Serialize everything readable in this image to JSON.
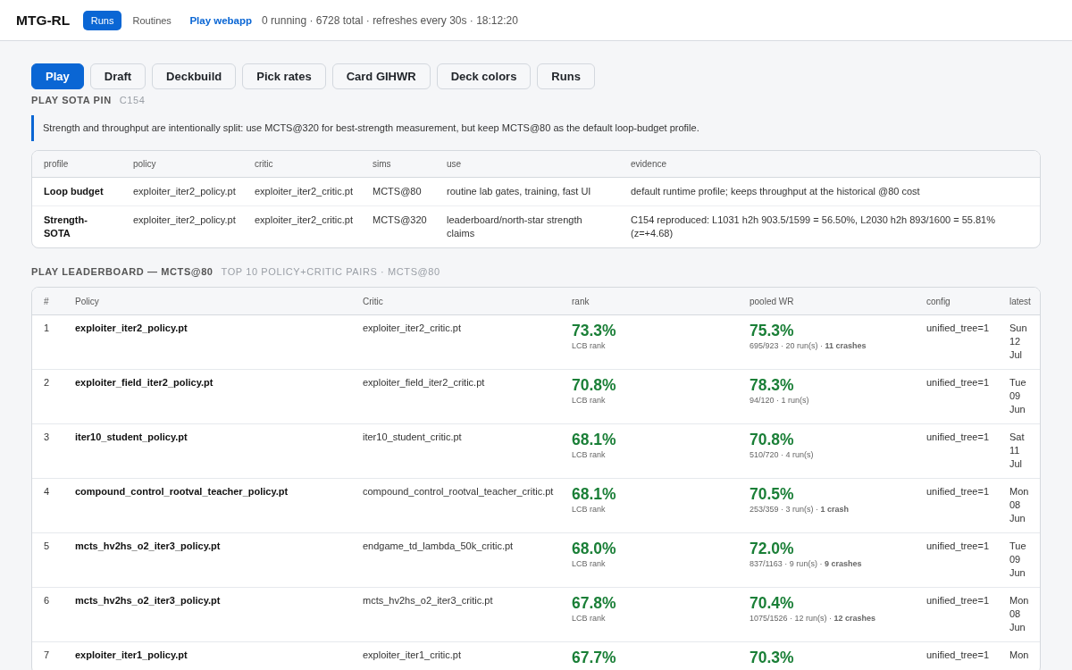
{
  "header": {
    "title": "MTG-RL",
    "nav": [
      {
        "label": "Runs",
        "selected": true
      },
      {
        "label": "Routines",
        "selected": false
      }
    ],
    "link": "Play webapp",
    "status": "0 running · 6728 total · refreshes every 30s · 18:12:20"
  },
  "tabs": [
    {
      "label": "Play",
      "selected": true
    },
    {
      "label": "Draft",
      "selected": false
    },
    {
      "label": "Deckbuild",
      "selected": false
    },
    {
      "label": "Pick rates",
      "selected": false
    },
    {
      "label": "Card GIHWR",
      "selected": false
    },
    {
      "label": "Deck colors",
      "selected": false
    },
    {
      "label": "Runs",
      "selected": false
    }
  ],
  "sota_pin": {
    "title": "PLAY SOTA PIN",
    "tag": "C154",
    "note": "Strength and throughput are intentionally split: use MCTS@320 for best-strength measurement, but keep MCTS@80 as the default loop-budget profile.",
    "table": {
      "columns": [
        "profile",
        "policy",
        "critic",
        "sims",
        "use",
        "evidence"
      ],
      "rows": [
        [
          "Loop budget",
          "exploiter_iter2_policy.pt",
          "exploiter_iter2_critic.pt",
          "MCTS@80",
          "routine lab gates, training, fast UI",
          "default runtime profile; keeps throughput at the historical @80 cost"
        ],
        [
          "Strength-SOTA",
          "exploiter_iter2_policy.pt",
          "exploiter_iter2_critic.pt",
          "MCTS@320",
          "leaderboard/north-star strength claims",
          "C154 reproduced: L1031 h2h 903.5/1599 = 56.50%, L2030 h2h 893/1600 = 55.81% (z=+4.68)"
        ]
      ]
    }
  },
  "leaderboard": {
    "title": "PLAY LEADERBOARD — MCTS@80",
    "subtitle": "TOP 10 POLICY+CRITIC PAIRS · MCTS@80",
    "columns": [
      "#",
      "Policy",
      "Critic",
      "rank",
      "pooled WR",
      "config",
      "latest"
    ],
    "rows": [
      {
        "number": "1",
        "policy": "exploiter_iter2_policy.pt",
        "critic": "exploiter_iter2_critic.pt",
        "rank": "73.3%",
        "rank_label": "LCB rank",
        "pooled_wr": "75.3%",
        "pooled_detail": "695/923 · 20 run(s) · **11 crashes**",
        "config": "unified_tree=1",
        "latest": "Sun 12 Jul"
      },
      {
        "number": "2",
        "policy": "exploiter_field_iter2_policy.pt",
        "critic": "exploiter_field_iter2_critic.pt",
        "rank": "70.8%",
        "rank_label": "LCB rank",
        "pooled_wr": "78.3%",
        "pooled_detail": "94/120 · 1 run(s)",
        "config": "unified_tree=1",
        "latest": "Tue 09 Jun"
      },
      {
        "number": "3",
        "policy": "iter10_student_policy.pt",
        "critic": "iter10_student_critic.pt",
        "rank": "68.1%",
        "rank_label": "LCB rank",
        "pooled_wr": "70.8%",
        "pooled_detail": "510/720 · 4 run(s)",
        "config": "unified_tree=1",
        "latest": "Sat 11 Jul"
      },
      {
        "number": "4",
        "policy": "compound_control_rootval_teacher_policy.pt",
        "critic": "compound_control_rootval_teacher_critic.pt",
        "rank": "68.1%",
        "rank_label": "LCB rank",
        "pooled_wr": "70.5%",
        "pooled_detail": "253/359 · 3 run(s) · **1 crash**",
        "config": "unified_tree=1",
        "latest": "Mon 08 Jun"
      },
      {
        "number": "5",
        "policy": "mcts_hv2hs_o2_iter3_policy.pt",
        "critic": "endgame_td_lambda_50k_critic.pt",
        "rank": "68.0%",
        "rank_label": "LCB rank",
        "pooled_wr": "72.0%",
        "pooled_detail": "837/1163 · 9 run(s) · **9 crashes**",
        "config": "unified_tree=1",
        "latest": "Tue 09 Jun"
      },
      {
        "number": "6",
        "policy": "mcts_hv2hs_o2_iter3_policy.pt",
        "critic": "mcts_hv2hs_o2_iter3_critic.pt",
        "rank": "67.8%",
        "rank_label": "LCB rank",
        "pooled_wr": "70.4%",
        "pooled_detail": "1075/1526 · 12 run(s) · **12 crashes**",
        "config": "unified_tree=1",
        "latest": "Mon 08 Jun"
      },
      {
        "number": "7",
        "policy": "exploiter_iter1_policy.pt",
        "critic": "exploiter_iter1_critic.pt",
        "rank": "67.7%",
        "pooled_wr": "70.3%",
        "config": "unified_tree=1",
        "latest": "Mon"
      }
    ]
  }
}
